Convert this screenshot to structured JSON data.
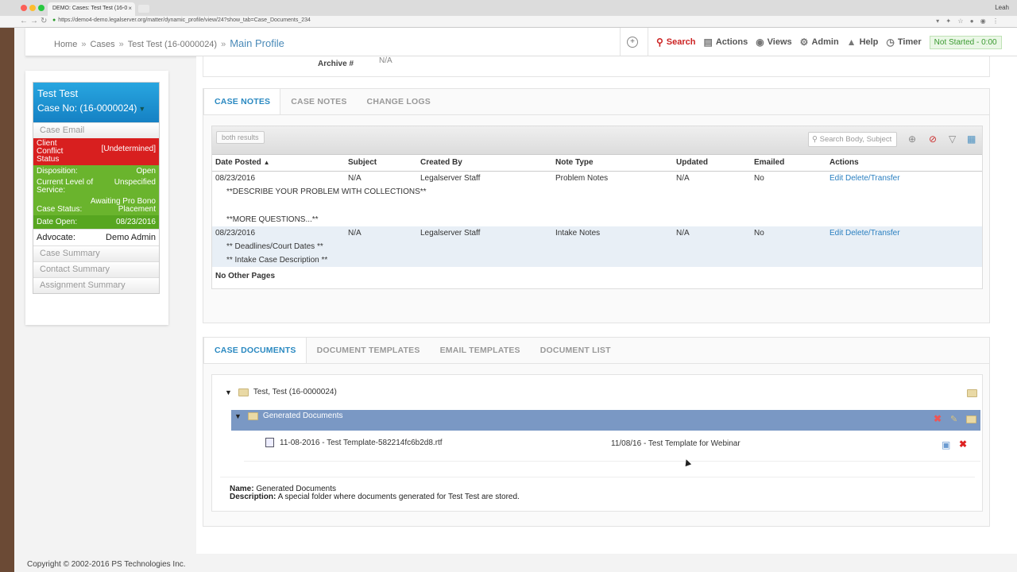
{
  "browser": {
    "tab_title": "DEMO: Cases: Test Test (16-0",
    "url": "https://demo4-demo.legalserver.org/matter/dynamic_profile/view/24?show_tab=Case_Documents_234",
    "user": "Leah"
  },
  "breadcrumb": {
    "items": [
      "Home",
      "Cases",
      "Test Test (16-0000024)"
    ],
    "separator": "»",
    "current": "Main Profile"
  },
  "topmenu": {
    "search": "Search",
    "actions": "Actions",
    "views": "Views",
    "admin": "Admin",
    "help": "Help",
    "timer": "Timer",
    "timer_status": "Not Started - 0:00"
  },
  "case": {
    "name": "Test Test",
    "case_no": "Case No: (16-0000024)",
    "links": [
      "Case Email",
      "Case Summary",
      "Contact Summary",
      "Assignment Summary"
    ],
    "conflict_label": "Client Conflict Status",
    "conflict_value": "[Undetermined]",
    "disposition_label": "Disposition:",
    "disposition_value": "Open",
    "level_label": "Current Level of Service:",
    "level_value": "Unspecified",
    "status_label": "Case Status:",
    "status_value": "Awaiting Pro Bono Placement",
    "date_open_label": "Date Open:",
    "date_open_value": "08/23/2016",
    "advocate_label": "Advocate:",
    "advocate_value": "Demo Admin"
  },
  "archive": {
    "label": "Archive #",
    "value": "N/A"
  },
  "notes_panel": {
    "tabs": [
      "CASE NOTES",
      "CASE NOTES",
      "CHANGE LOGS"
    ],
    "both_results": "both results",
    "search_placeholder": "Search Body, Subject",
    "columns": [
      "Date Posted",
      "Subject",
      "Created By",
      "Note Type",
      "Updated",
      "Emailed",
      "Actions"
    ],
    "rows": [
      {
        "date": "08/23/2016",
        "subject": "N/A",
        "created_by": "Legalserver Staff",
        "note_type": "Problem Notes",
        "updated": "N/A",
        "emailed": "No",
        "actions": "Edit Delete/Transfer",
        "body": [
          "**DESCRIBE YOUR PROBLEM WITH COLLECTIONS**",
          "**MORE QUESTIONS...**"
        ]
      },
      {
        "date": "08/23/2016",
        "subject": "N/A",
        "created_by": "Legalserver Staff",
        "note_type": "Intake Notes",
        "updated": "N/A",
        "emailed": "No",
        "actions": "Edit Delete/Transfer",
        "body": [
          "** Deadlines/Court Dates **",
          "** Intake Case Description **"
        ]
      }
    ],
    "no_other_pages": "No Other Pages"
  },
  "docs_panel": {
    "tabs": [
      "CASE DOCUMENTS",
      "DOCUMENT TEMPLATES",
      "EMAIL TEMPLATES",
      "DOCUMENT LIST"
    ],
    "root_folder": "Test, Test (16-0000024)",
    "sub_folder": "Generated Documents",
    "file_name": "11-08-2016 - Test Template-582214fc6b2d8.rtf",
    "file_desc": "11/08/16 - Test Template for Webinar",
    "name_label": "Name:",
    "name_value": "Generated Documents",
    "desc_label": "Description:",
    "desc_value": "A special folder where documents generated for Test Test are stored."
  },
  "footer": {
    "copyright": "Copyright © 2002-2016 PS Technologies Inc."
  }
}
